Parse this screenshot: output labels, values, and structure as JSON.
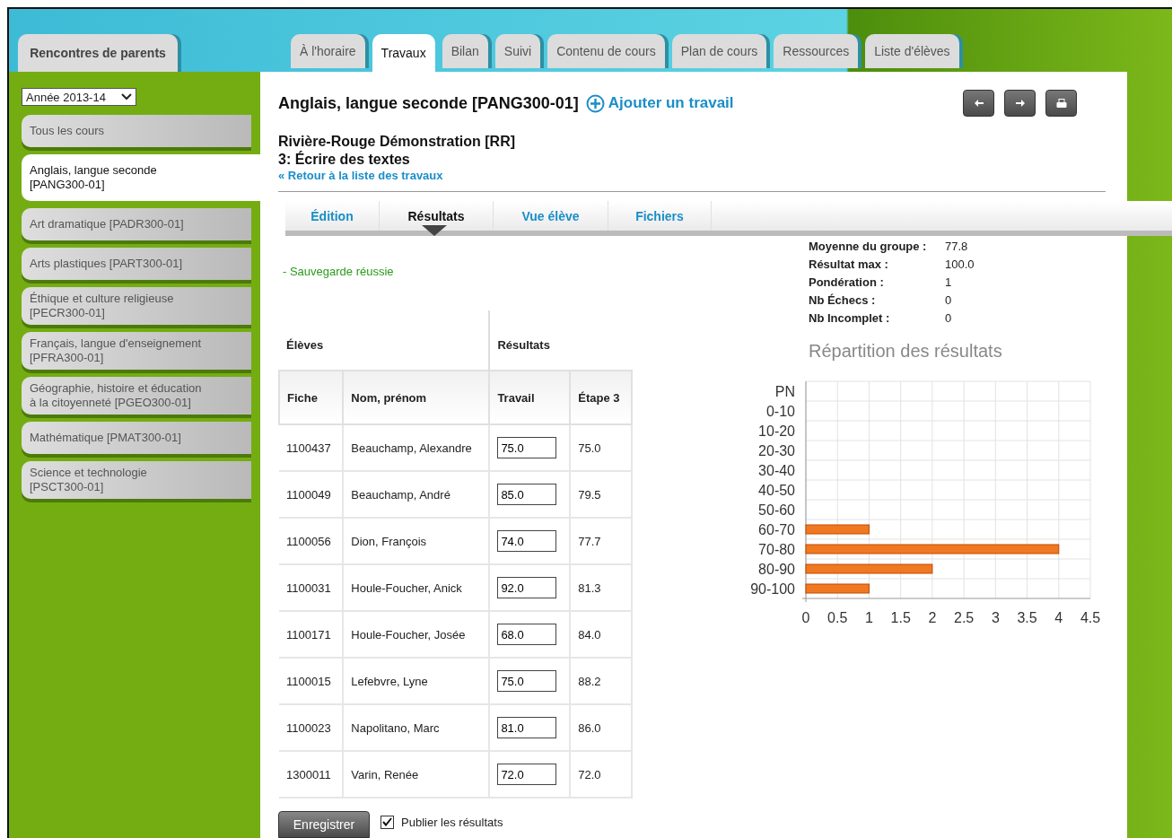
{
  "top_tab": "Rencontres de parents",
  "tabs": [
    {
      "label": "À l'horaire",
      "selected": false
    },
    {
      "label": "Travaux",
      "selected": true
    },
    {
      "label": "Bilan",
      "selected": false
    },
    {
      "label": "Suivi",
      "selected": false
    },
    {
      "label": "Contenu de cours",
      "selected": false
    },
    {
      "label": "Plan de cours",
      "selected": false
    },
    {
      "label": "Ressources",
      "selected": false
    },
    {
      "label": "Liste d'élèves",
      "selected": false
    }
  ],
  "year_select": "Année 2013-14",
  "sidebar": {
    "items": [
      {
        "label": "Tous les cours",
        "selected": false
      },
      {
        "label": "Anglais, langue seconde [PANG300-01]",
        "selected": true
      },
      {
        "label": "Art dramatique [PADR300-01]",
        "selected": false
      },
      {
        "label": "Arts plastiques [PART300-01]",
        "selected": false
      },
      {
        "label": "Éthique et culture religieuse [PECR300-01]",
        "selected": false
      },
      {
        "label": "Français, langue d'enseignement [PFRA300-01]",
        "selected": false
      },
      {
        "label": "Géographie, histoire et éducation à la citoyenneté [PGEO300-01]",
        "selected": false
      },
      {
        "label": "Mathématique [PMAT300-01]",
        "selected": false
      },
      {
        "label": "Science et technologie [PSCT300-01]",
        "selected": false
      }
    ]
  },
  "course_title": "Anglais, langue seconde [PANG300-01]",
  "add_link": "Ajouter un travail",
  "school": "Rivière-Rouge Démonstration [RR]",
  "assignment": "3: Écrire des textes",
  "back_link": "« Retour à la liste des travaux",
  "subtabs": [
    {
      "label": "Édition",
      "selected": false
    },
    {
      "label": "Résultats",
      "selected": true
    },
    {
      "label": "Vue élève",
      "selected": false
    },
    {
      "label": "Fichiers",
      "selected": false
    }
  ],
  "message": "- Sauvegarde réussie",
  "table": {
    "groups": [
      "Élèves",
      "Résultats"
    ],
    "columns": [
      "Fiche",
      "Nom, prénom",
      "Travail",
      "Étape 3"
    ],
    "rows": [
      {
        "fiche": "1100437",
        "name": "Beauchamp, Alexandre",
        "travail": "75.0",
        "etape": "75.0"
      },
      {
        "fiche": "1100049",
        "name": "Beauchamp, André",
        "travail": "85.0",
        "etape": "79.5"
      },
      {
        "fiche": "1100056",
        "name": "Dion, François",
        "travail": "74.0",
        "etape": "77.7"
      },
      {
        "fiche": "1100031",
        "name": "Houle-Foucher, Anick",
        "travail": "92.0",
        "etape": "81.3"
      },
      {
        "fiche": "1100171",
        "name": "Houle-Foucher, Josée",
        "travail": "68.0",
        "etape": "84.0"
      },
      {
        "fiche": "1100015",
        "name": "Lefebvre, Lyne",
        "travail": "75.0",
        "etape": "88.2"
      },
      {
        "fiche": "1100023",
        "name": "Napolitano, Marc",
        "travail": "81.0",
        "etape": "86.0"
      },
      {
        "fiche": "1300011",
        "name": "Varin, Renée",
        "travail": "72.0",
        "etape": "72.0"
      }
    ]
  },
  "save_button": "Enregistrer",
  "publish": {
    "label": "Publier les résultats",
    "checked": true
  },
  "stats": [
    {
      "label": "Moyenne du groupe :",
      "value": "77.8"
    },
    {
      "label": "Résultat max :",
      "value": "100.0"
    },
    {
      "label": "Pondération :",
      "value": "1"
    },
    {
      "label": "Nb Échecs :",
      "value": "0"
    },
    {
      "label": "Nb Incomplet :",
      "value": "0"
    }
  ],
  "chart": {
    "chart_data": {
      "type": "bar",
      "orientation": "horizontal",
      "title": "Répartition des résultats",
      "categories": [
        "PN",
        "0-10",
        "10-20",
        "20-30",
        "30-40",
        "40-50",
        "50-60",
        "60-70",
        "70-80",
        "80-90",
        "90-100"
      ],
      "series": [
        {
          "color": "#f07820",
          "values": [
            0,
            0,
            0,
            0,
            0,
            0,
            0,
            1,
            4,
            2,
            1
          ]
        }
      ],
      "grid": true,
      "xlim": [
        0,
        4.5
      ],
      "xticks": [
        0,
        0.5,
        1,
        1.5,
        2,
        2.5,
        3,
        3.5,
        4,
        4.5
      ]
    }
  }
}
